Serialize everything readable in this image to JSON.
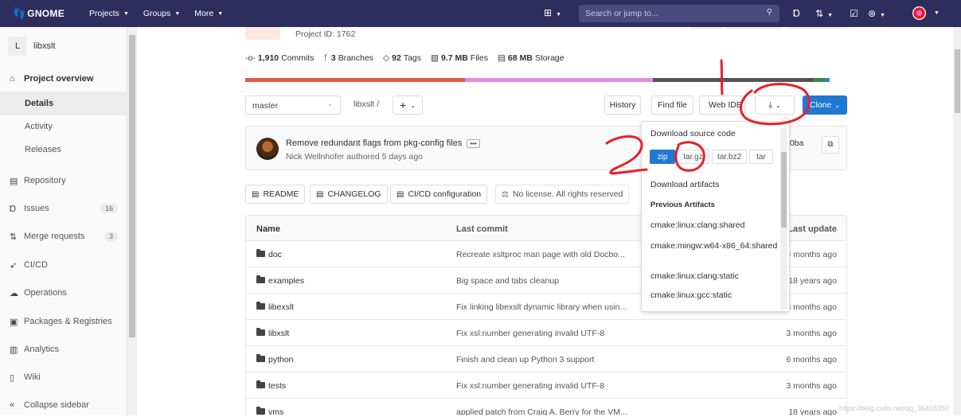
{
  "navbar": {
    "brand": "GNOME",
    "links": [
      {
        "label": "Projects"
      },
      {
        "label": "Groups"
      },
      {
        "label": "More"
      }
    ],
    "search_placeholder": "Search or jump to..."
  },
  "sidebar": {
    "project_initial": "L",
    "project_name": "libxslt",
    "items": [
      {
        "label": "Project overview",
        "icon": "home-icon"
      },
      {
        "label": "Details"
      },
      {
        "label": "Activity"
      },
      {
        "label": "Releases"
      },
      {
        "label": "Repository",
        "icon": "book-icon"
      },
      {
        "label": "Issues",
        "icon": "issues-icon",
        "count": "16"
      },
      {
        "label": "Merge requests",
        "icon": "merge-request-icon",
        "count": "3"
      },
      {
        "label": "CI/CD",
        "icon": "rocket-icon"
      },
      {
        "label": "Operations",
        "icon": "cloud-icon"
      },
      {
        "label": "Packages & Registries",
        "icon": "package-icon"
      },
      {
        "label": "Analytics",
        "icon": "chart-icon"
      },
      {
        "label": "Wiki",
        "icon": "wiki-icon"
      },
      {
        "label": "Collapse sidebar",
        "icon": "collapse-icon"
      }
    ]
  },
  "project": {
    "id_text": "Project ID: 1762",
    "stats": {
      "commits_count": "1,910",
      "commits_label": "Commits",
      "branches_count": "3",
      "branches_label": "Branches",
      "tags_count": "92",
      "tags_label": "Tags",
      "files_size": "9.7 MB",
      "files_label": "Files",
      "storage_size": "68 MB",
      "storage_label": "Storage"
    },
    "language_colors": [
      "#e05d44",
      "#e28ce0",
      "#555555",
      "#3c8c2f",
      "#2f7fc8"
    ]
  },
  "toolbar": {
    "branch": "master",
    "path": "libxslt",
    "path_separator": "/",
    "plus": "+",
    "history": "History",
    "find_file": "Find file",
    "web_ide": "Web IDE",
    "clone": "Clone"
  },
  "last_commit": {
    "title": "Remove redundant flags from pkg-config files",
    "author": "Nick Wellnhofer",
    "meta": "authored 5 days ago",
    "sha_fragment": "00ba"
  },
  "file_buttons": [
    {
      "label": "README",
      "icon": "doc-icon"
    },
    {
      "label": "CHANGELOG",
      "icon": "doc-icon"
    },
    {
      "label": "CI/CD configuration",
      "icon": "doc-icon"
    },
    {
      "label": "No license. All rights reserved",
      "icon": "scale-icon"
    }
  ],
  "table": {
    "headers": {
      "name": "Name",
      "last_commit": "Last commit",
      "last_update": "Last update"
    },
    "rows": [
      {
        "name": "doc",
        "commit": "Recreate xsltproc man page with old Docbo...",
        "date": "3 months ago"
      },
      {
        "name": "examples",
        "commit": "Big space and tabs cleanup",
        "date": "18 years ago"
      },
      {
        "name": "libexslt",
        "commit": "Fix linking libexslt dynamic library when usin...",
        "date": "3 months ago"
      },
      {
        "name": "libxslt",
        "commit": "Fix xsl:number generating invalid UTF-8",
        "date": "3 months ago"
      },
      {
        "name": "python",
        "commit": "Finish and clean up Python 3 support",
        "date": "6 months ago"
      },
      {
        "name": "tests",
        "commit": "Fix xsl:number generating invalid UTF-8",
        "date": "3 months ago"
      },
      {
        "name": "vms",
        "commit": "applied patch from Craig A. Berry for the VM...",
        "date": "18 years ago"
      }
    ]
  },
  "download_menu": {
    "source_heading": "Download source code",
    "formats": [
      "zip",
      "tar.gz",
      "tar.bz2",
      "tar"
    ],
    "selected_format": "zip",
    "artifacts_heading": "Download artifacts",
    "previous_label": "Previous Artifacts",
    "artifacts": [
      "cmake:linux:clang:shared",
      "cmake:mingw:w64-x86_64:shared",
      "cmake:linux:clang:static",
      "cmake:linux:gcc:static"
    ]
  },
  "watermark": "https://blog.csdn.net/qq_36416350",
  "colors": {
    "navbar": "#2e2e5e",
    "primary": "#1f78d1",
    "annotation": "#e8202a"
  }
}
